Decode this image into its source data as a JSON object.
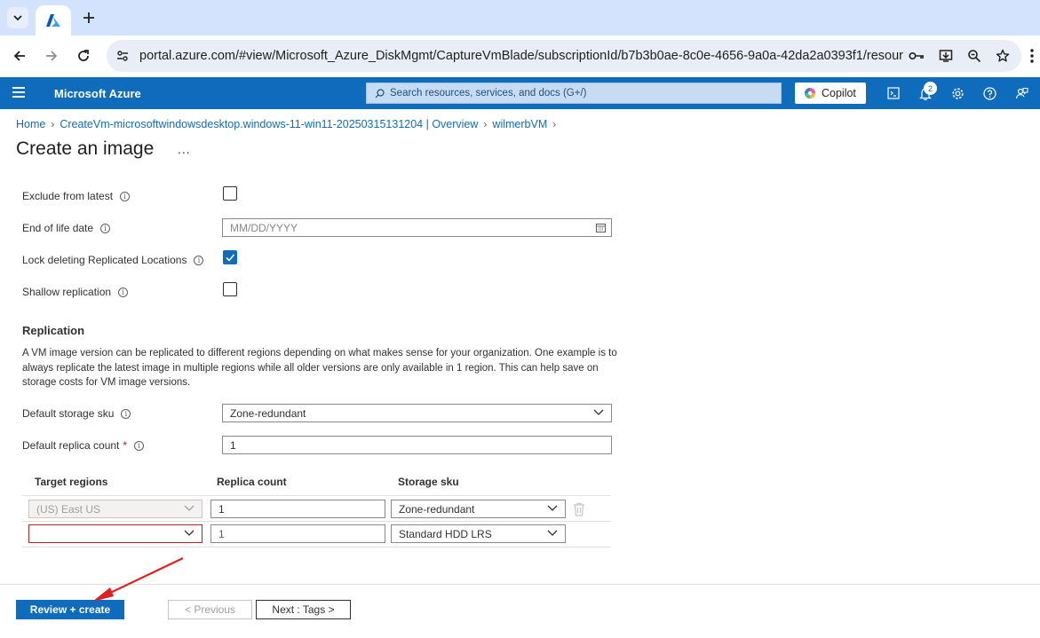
{
  "browser": {
    "url": "portal.azure.com/#view/Microsoft_Azure_DiskMgmt/CaptureVmBlade/subscriptionId/b7b3b0ae-8c0e-4656-9a0a-42da2a0393f1/resource..."
  },
  "header": {
    "brand": "Microsoft Azure",
    "search_placeholder": "Search resources, services, and docs (G+/)",
    "copilot_label": "Copilot",
    "notification_count": "2",
    "accent_color": "#0f6cbd"
  },
  "breadcrumb": {
    "items": [
      "Home",
      "CreateVm-microsoftwindowsdesktop.windows-11-win11-20250315131204 | Overview",
      "wilmerbVM"
    ]
  },
  "page": {
    "title": "Create an image",
    "more": "..."
  },
  "form": {
    "exclude_from_latest": {
      "label": "Exclude from latest",
      "checked": false
    },
    "end_of_life_date": {
      "label": "End of life date",
      "placeholder": "MM/DD/YYYY"
    },
    "lock_deleting": {
      "label": "Lock deleting Replicated Locations",
      "checked": true
    },
    "shallow_replication": {
      "label": "Shallow replication",
      "checked": false
    }
  },
  "replication": {
    "title": "Replication",
    "description": "A VM image version can be replicated to different regions depending on what makes sense for your organization. One example is to always replicate the latest image in multiple regions while all older versions are only available in 1 region. This can help save on storage costs for VM image versions.",
    "default_storage_sku": {
      "label": "Default storage sku",
      "value": "Zone-redundant"
    },
    "default_replica_count": {
      "label": "Default replica count",
      "required": "*",
      "value": "1"
    },
    "table": {
      "headers": [
        "Target regions",
        "Replica count",
        "Storage sku"
      ],
      "rows": [
        {
          "region": "(US) East US",
          "replica": "1",
          "sku": "Zone-redundant"
        },
        {
          "region": "",
          "replica": "1",
          "sku": "Standard HDD LRS"
        }
      ]
    }
  },
  "footer": {
    "review_create": "Review + create",
    "previous": "< Previous",
    "next": "Next : Tags >"
  }
}
